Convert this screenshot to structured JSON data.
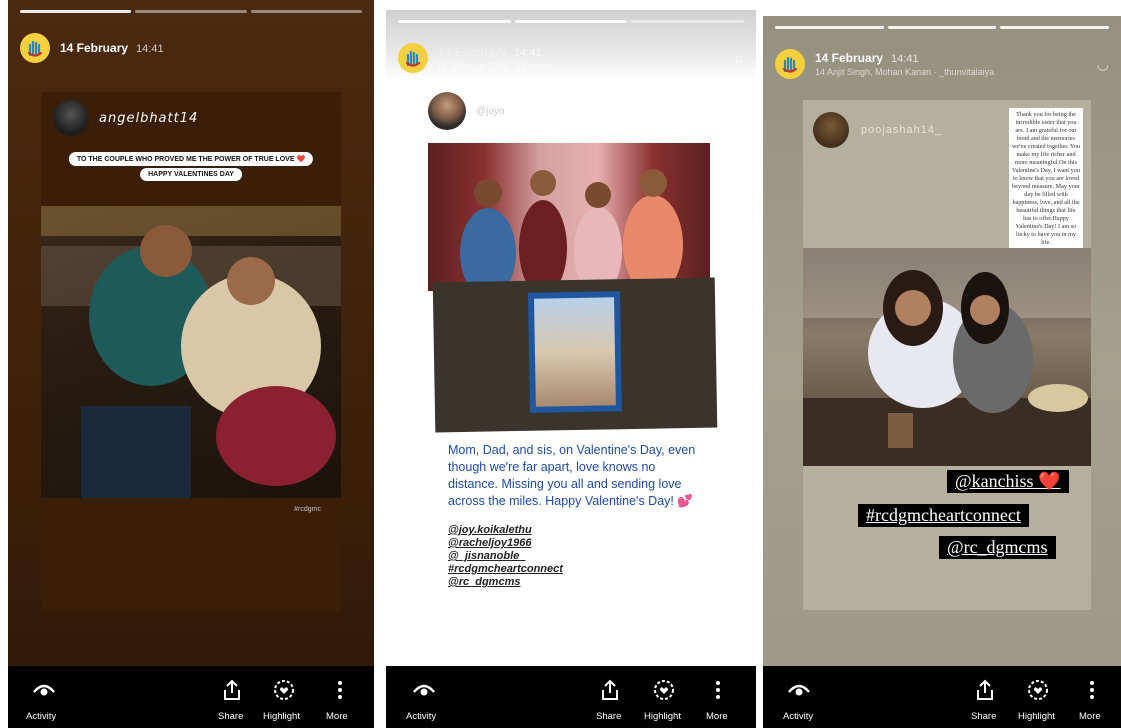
{
  "stories": [
    {
      "header": {
        "date": "14 February",
        "time": "14:41",
        "subtitle": ""
      },
      "repost": {
        "username": "angelbhatt14",
        "sticker_lines": [
          "TO THE COUPLE WHO PROVED ME THE POWER OF TRUE LOVE ❤️",
          "HAPPY VALENTINES DAY"
        ],
        "hashtag": "#rcdgmc"
      }
    },
    {
      "header": {
        "date": "14 February",
        "time": "14:41",
        "subtitle": "Dr. Monique Baid · 3 Frames"
      },
      "repost": {
        "username": "@joyo",
        "caption": "Mom, Dad, and sis, on Valentine's Day, even though we're far apart, love knows no distance. Missing you all and sending love across the miles. Happy Valentine's Day!",
        "caption_emoji": "💕",
        "mentions": [
          "@joy.koikalethu",
          "@racheljoy1966",
          "@_jisnanoble_",
          "#rcdgmcheartconnect",
          "@rc_dgmcms"
        ]
      }
    },
    {
      "header": {
        "date": "14 February",
        "time": "14:41",
        "subtitle": "14 Anjit Singh, Mohan Kanan · _thunvitalaiya"
      },
      "repost": {
        "username": "poojashah14_",
        "note": "Thank you for being the incredible sister that you are. I am grateful for our bond and the memories we've created together. You make my life richer and more meaningful.On this Valentine's Day, I want you to know that you are loved beyond measure. May your day be filled with happiness, love, and all the beautiful things that life has to offer.Happy Valentine's Day! I am so lucky to have you in my life.",
        "tags": [
          "@kanchiss",
          "#rcdgmcheartconnect",
          "@rc_dgmcms"
        ],
        "tag_emoji": "❤️"
      }
    }
  ],
  "bottom_bar": {
    "activity": "Activity",
    "share": "Share",
    "highlight": "Highlight",
    "more": "More"
  },
  "colors": {
    "panel1_bg": "#3d2009",
    "panel3_bg": "#a4a08d",
    "caption_blue": "#1f4aa8"
  }
}
